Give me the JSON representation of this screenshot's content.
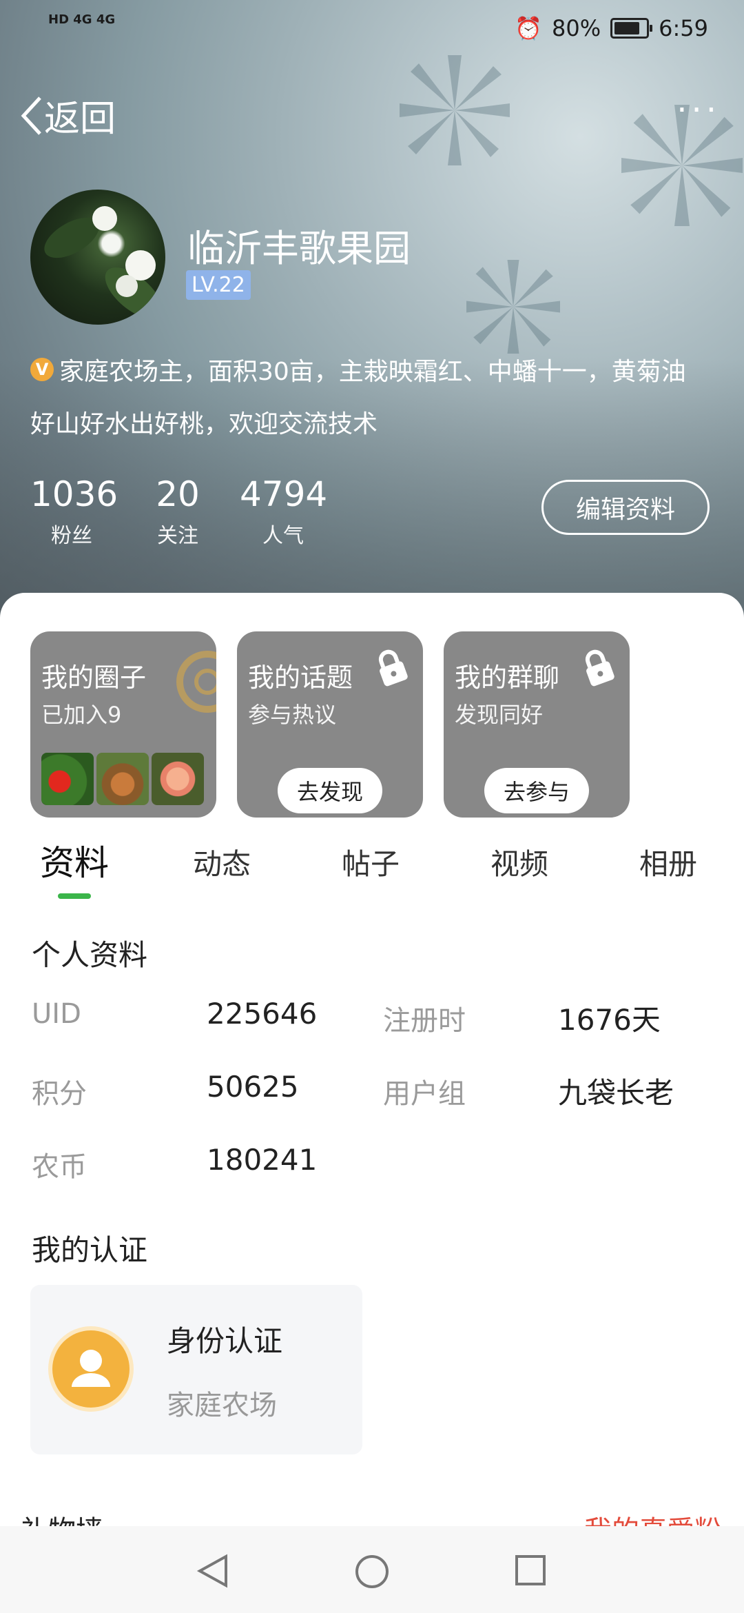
{
  "status_bar": {
    "network": "HD 4G 4G",
    "battery": "80%",
    "time": "6:59"
  },
  "nav": {
    "back_label": "返回",
    "more_label": "···"
  },
  "profile": {
    "name": "临沂丰歌果园",
    "level": "LV.22",
    "bio_line1": "家庭农场主，面积30亩，主栽映霜红、中蟠十一，黄菊油",
    "bio_line2": "好山好水出好桃，欢迎交流技术",
    "verified_badge": "V",
    "stats": [
      {
        "value": "1036",
        "label": "粉丝"
      },
      {
        "value": "20",
        "label": "关注"
      },
      {
        "value": "4794",
        "label": "人气"
      }
    ],
    "edit_button": "编辑资料"
  },
  "cards": [
    {
      "title": "我的圈子",
      "subtitle": "已加入9"
    },
    {
      "title": "我的话题",
      "subtitle": "参与热议",
      "button": "去发现"
    },
    {
      "title": "我的群聊",
      "subtitle": "发现同好",
      "button": "去参与"
    }
  ],
  "tabs": [
    "资料",
    "动态",
    "帖子",
    "视频",
    "相册"
  ],
  "personal_info": {
    "title": "个人资料",
    "fields": [
      {
        "label": "UID",
        "value": "225646"
      },
      {
        "label": "注册时",
        "value": "1676天"
      },
      {
        "label": "积分",
        "value": "50625"
      },
      {
        "label": "用户组",
        "value": "九袋长老"
      },
      {
        "label": "农币",
        "value": "180241"
      }
    ]
  },
  "certification": {
    "title": "我的认证",
    "item_title": "身份认证",
    "item_subtitle": "家庭农场"
  },
  "gift_wall": {
    "title": "礼物墙",
    "link": "我的真爱粉"
  },
  "colors": {
    "accent_green": "#3bb54a",
    "level_blue": "#8fb3e9",
    "badge_orange": "#f1a93a",
    "link_red": "#e34b3b"
  }
}
